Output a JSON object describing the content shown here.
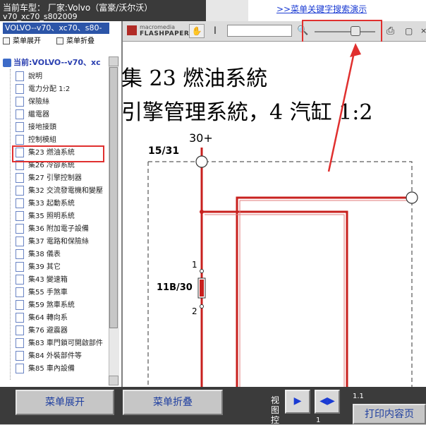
{
  "header": {
    "title_line1": "当前车型： 厂家:Volvo（富豪/沃尔沃）",
    "title_line2": "v70_xc70_s802009",
    "banner_link": ">>菜单关键字搜索演示"
  },
  "left_panel": {
    "car_tab": "VOLVO--v70、xc70、s80-",
    "expand_label": "菜单展开",
    "collapse_label": "菜单折叠",
    "tree_root": "当前:VOLVO--v70、xc",
    "items": [
      "說明",
      "電力分配 1:2",
      "保險絲",
      "繼電器",
      "接地接頭",
      "控制模組",
      "集23 燃油系統",
      "集26 冷卻系統",
      "集27 引擎控制器",
      "集32 交流發電機和變壓",
      "集33 起動系統",
      "集35 照明系統",
      "集36 附加電子設備",
      "集37 電路和保險絲",
      "集38 儀表",
      "集39 其它",
      "集43 變速箱",
      "集55 手煞車",
      "集59 煞車系統",
      "集64 轉向系",
      "集76 避震器",
      "集83 車門鎖可開啟部件",
      "集84 外裝部件等",
      "集85 車內設備"
    ]
  },
  "viewer": {
    "logo_line1": "macromedia",
    "logo_line2": "FLASHPAPER",
    "zoom_level": 0.68,
    "doc_title_line1": "集 23 燃油系統",
    "doc_title_line2": "引擎管理系統，4 汽缸 1:2",
    "label_30": "30+",
    "label_1531": "15/31",
    "label_11b30": "11B/30",
    "pin1": "1",
    "pin2": "2"
  },
  "bottom": {
    "expand_label": "菜单展开",
    "collapse_label": "菜单折叠",
    "view_control_label": "视图控",
    "page_indicator": "1.1",
    "page_number": "1",
    "print_label": "打印内容页"
  },
  "colors": {
    "wire": "#c8201e",
    "highlight": "#e0302f",
    "tab_blue": "#2c55a8"
  }
}
